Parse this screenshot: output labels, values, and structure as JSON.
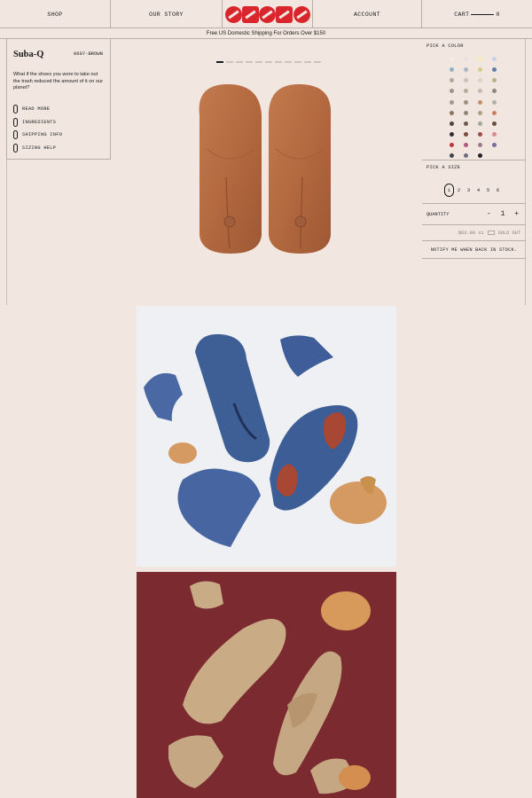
{
  "nav": {
    "shop": "SHOP",
    "our_story": "OUR STORY",
    "logo_text": "OOOTO",
    "account": "ACCOUNT",
    "cart_label": "CART",
    "cart_count": "0"
  },
  "banner": "Free US Domestic Shipping For Orders Over $150",
  "product": {
    "name": "Suba-Q",
    "sku": "0607-BROWN",
    "description": "What if the shoes you wore to take out the trash reduced the amount of it on our planet?",
    "links": [
      "READ MORE",
      "INGREDIENTS",
      "SHIPPING INFO",
      "SIZING HELP"
    ]
  },
  "carousel": {
    "total": 11,
    "active": 1
  },
  "colors": {
    "label": "PICK A COLOR",
    "swatches": [
      "#f3ede9",
      "#e8e1dc",
      "#f6edb8",
      "#c5d5e6",
      "#8fb2cc",
      "#a8b6c6",
      "#d7cc8a",
      "#5f7fa6",
      "#b7a895",
      "#c9c2ba",
      "#ddd2c4",
      "#bfae88",
      "#9a948d",
      "#b8ad98",
      "#c7b9a9",
      "#8d877c",
      "#a39b90",
      "#9d8f7e",
      "#c58e6a",
      "#aeb3a5",
      "#8c7664",
      "#8e8775",
      "#b09e85",
      "#c87f61",
      "#4e463f",
      "#6d5a4c",
      "#a7a59a",
      "#6a4d3d",
      "#2f2f31",
      "#7a4a3a",
      "#9c4a46",
      "#d58b8f",
      "#c23636",
      "#b6547f",
      "#a07a8b",
      "#7a6a95",
      "#424448",
      "#69707b",
      "#222226"
    ]
  },
  "sizes": {
    "label": "PICK A SIZE",
    "options": [
      "1",
      "2",
      "3",
      "4",
      "5",
      "6"
    ],
    "selected": "1"
  },
  "quantity": {
    "label": "QUANTITY",
    "minus": "-",
    "value": "1",
    "plus": "+"
  },
  "price": {
    "amount": "$63.00 x1",
    "status": "SOLD OUT"
  },
  "notify": "NOTIFY ME WHEN BACK IN STOCK."
}
